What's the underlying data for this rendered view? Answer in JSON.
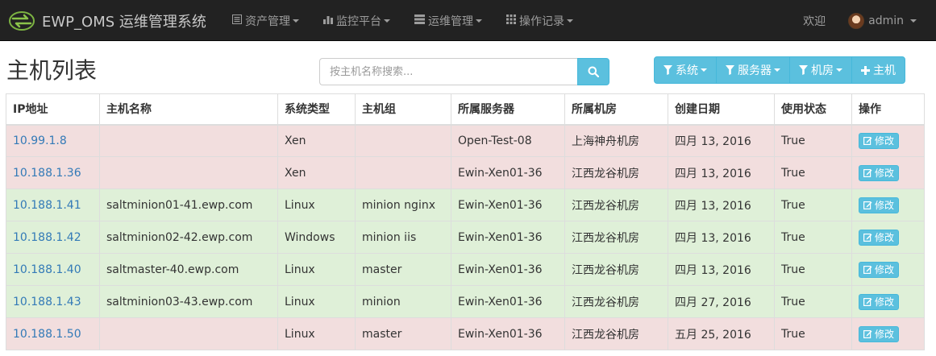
{
  "navbar": {
    "brand": "EWP_OMS 运维管理系统",
    "menus": [
      {
        "label": "资产管理",
        "icon": "list-alt-icon"
      },
      {
        "label": "监控平台",
        "icon": "bar-chart-icon"
      },
      {
        "label": "运维管理",
        "icon": "tasks-icon"
      },
      {
        "label": "操作记录",
        "icon": "th-icon"
      }
    ],
    "welcome": "欢迎",
    "user": "admin"
  },
  "page": {
    "title": "主机列表",
    "search_placeholder": "按主机名称搜索..."
  },
  "filters": [
    {
      "label": "系统",
      "icon": "filter-icon",
      "dropdown": true
    },
    {
      "label": "服务器",
      "icon": "filter-icon",
      "dropdown": true
    },
    {
      "label": "机房",
      "icon": "filter-icon",
      "dropdown": true
    },
    {
      "label": "主机",
      "icon": "plus-icon",
      "dropdown": false
    }
  ],
  "table": {
    "headers": [
      "IP地址",
      "主机名称",
      "系统类型",
      "主机组",
      "所属服务器",
      "所属机房",
      "创建日期",
      "使用状态",
      "操作"
    ],
    "action_label": "修改",
    "colors": {
      "danger": "#f2dede",
      "success": "#dff0d8",
      "link": "#337ab7",
      "info": "#5bc0de"
    },
    "rows": [
      {
        "state": "danger",
        "ip": "10.99.1.8",
        "hostname": "",
        "os": "Xen",
        "group": "",
        "server": "Open-Test-08",
        "room": "上海神舟机房",
        "date": "四月 13, 2016",
        "status": "True"
      },
      {
        "state": "danger",
        "ip": "10.188.1.36",
        "hostname": "",
        "os": "Xen",
        "group": "",
        "server": "Ewin-Xen01-36",
        "room": "江西龙谷机房",
        "date": "四月 13, 2016",
        "status": "True"
      },
      {
        "state": "success",
        "ip": "10.188.1.41",
        "hostname": "saltminion01-41.ewp.com",
        "os": "Linux",
        "group": "minion nginx",
        "server": "Ewin-Xen01-36",
        "room": "江西龙谷机房",
        "date": "四月 13, 2016",
        "status": "True"
      },
      {
        "state": "success",
        "ip": "10.188.1.42",
        "hostname": "saltminion02-42.ewp.com",
        "os": "Windows",
        "group": "minion iis",
        "server": "Ewin-Xen01-36",
        "room": "江西龙谷机房",
        "date": "四月 13, 2016",
        "status": "True"
      },
      {
        "state": "success",
        "ip": "10.188.1.40",
        "hostname": "saltmaster-40.ewp.com",
        "os": "Linux",
        "group": "master",
        "server": "Ewin-Xen01-36",
        "room": "江西龙谷机房",
        "date": "四月 13, 2016",
        "status": "True"
      },
      {
        "state": "success",
        "ip": "10.188.1.43",
        "hostname": "saltminion03-43.ewp.com",
        "os": "Linux",
        "group": "minion",
        "server": "Ewin-Xen01-36",
        "room": "江西龙谷机房",
        "date": "四月 27, 2016",
        "status": "True"
      },
      {
        "state": "danger",
        "ip": "10.188.1.50",
        "hostname": "",
        "os": "Linux",
        "group": "master",
        "server": "Ewin-Xen01-36",
        "room": "江西龙谷机房",
        "date": "五月 25, 2016",
        "status": "True"
      }
    ]
  }
}
